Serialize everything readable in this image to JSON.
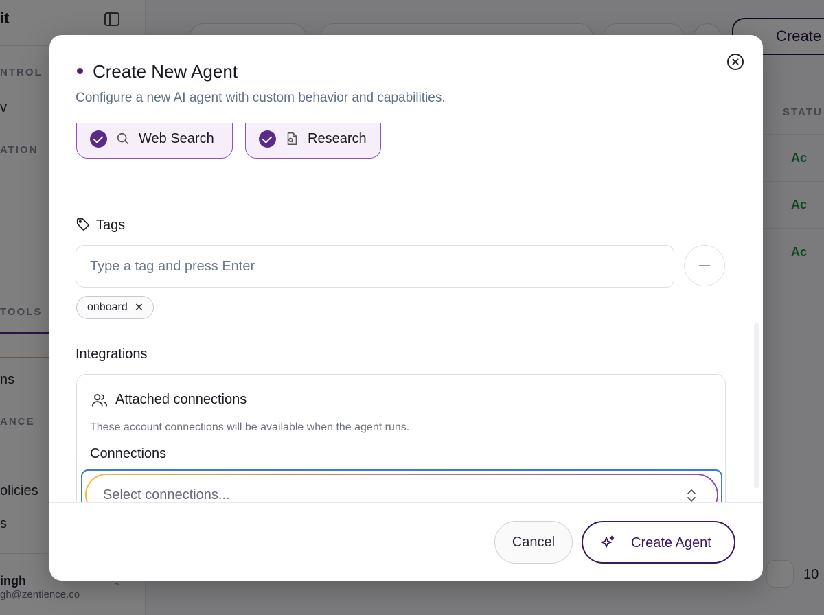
{
  "background": {
    "brand_fragment": "it",
    "sidebar_sections": [
      "NTROL",
      "ATION",
      "TOOLS",
      "ANCE"
    ],
    "sidebar_items": [
      "v",
      "ns",
      "olicies",
      "s"
    ],
    "user_name": "ingh",
    "user_email": "gh@zentience.co",
    "create_button": "Create",
    "table_header": "STATU",
    "status_rows": [
      "Ac",
      "Ac",
      "Ac"
    ],
    "zoom_text": "10"
  },
  "modal": {
    "title": "Create New Agent",
    "subtitle": "Configure a new AI agent with custom behavior and capabilities.",
    "capabilities": [
      {
        "label": "Web Search",
        "icon": "search-icon",
        "checked": true
      },
      {
        "label": "Research",
        "icon": "file-search-icon",
        "checked": true
      }
    ],
    "tags": {
      "label": "Tags",
      "placeholder": "Type a tag and press Enter",
      "items": [
        {
          "label": "onboard",
          "remove": "✕"
        }
      ]
    },
    "integrations": {
      "label": "Integrations",
      "card_title": "Attached connections",
      "card_description": "These account connections will be available when the agent runs.",
      "connections_label": "Connections",
      "connections_placeholder": "Select connections..."
    },
    "footer": {
      "cancel_label": "Cancel",
      "create_label": "Create Agent"
    }
  },
  "colors": {
    "accent": "#5b2a86",
    "focus_ring": "#3a7bd5",
    "subtitle": "#5f7089"
  }
}
